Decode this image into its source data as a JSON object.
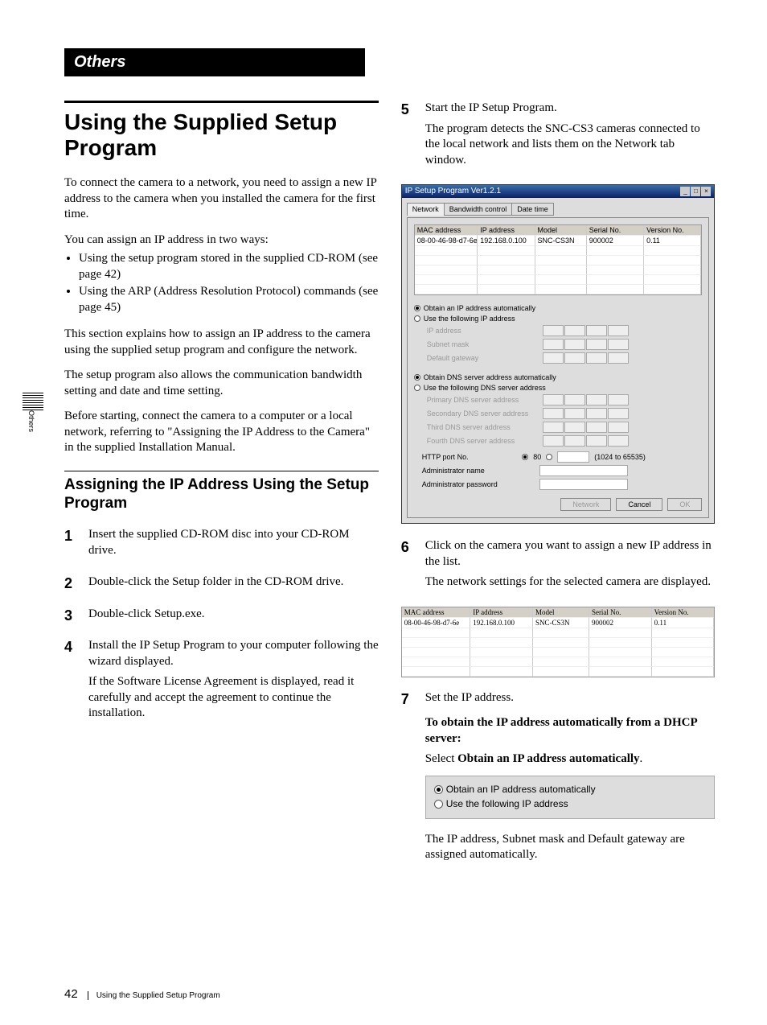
{
  "section_label": "Others",
  "title": "Using the Supplied Setup Program",
  "intro1": "To connect the camera to a network, you need to assign a new IP address to the camera when you installed the camera for the first time.",
  "intro2": "You can assign an IP address in two ways:",
  "bullets": [
    "Using the setup program stored in the supplied CD-ROM (see page 42)",
    "Using the ARP (Address Resolution Protocol) commands (see page 45)"
  ],
  "intro3": "This section explains how to assign an IP address to the camera using the supplied setup program and configure the network.",
  "intro4": "The setup program also allows the communication bandwidth setting and date and time setting.",
  "intro5": "Before starting, connect the camera to a computer or a local network, referring to \"Assigning the IP Address to the Camera\" in the supplied Installation Manual.",
  "subtitle": "Assigning the IP Address Using the Setup Program",
  "steps": {
    "s1": "Insert the supplied CD-ROM disc into your CD-ROM drive.",
    "s2": "Double-click the Setup folder in the CD-ROM drive.",
    "s3": "Double-click Setup.exe.",
    "s4a": "Install the IP Setup Program to your computer following the wizard displayed.",
    "s4b": "If the Software License Agreement is displayed, read it carefully and accept the agreement to continue the installation.",
    "s5a": "Start the IP Setup Program.",
    "s5b": "The program detects the SNC-CS3 cameras connected to the local network and lists them on the Network tab window.",
    "s6a": "Click on the camera you want to assign a new IP address in the list.",
    "s6b": "The network settings for the selected camera are displayed.",
    "s7": "Set the IP address.",
    "s7_heading": "To obtain the IP address automatically from a DHCP server:",
    "s7_select_prefix": "Select ",
    "s7_select_bold": "Obtain an IP address automatically",
    "s7_select_suffix": ".",
    "s7_after": "The IP address, Subnet mask and Default gateway are assigned automatically."
  },
  "window": {
    "title": "IP Setup Program Ver1.2.1",
    "tabs": [
      "Network",
      "Bandwidth control",
      "Date time"
    ],
    "cols": [
      "MAC address",
      "IP address",
      "Model",
      "Serial No.",
      "Version No."
    ],
    "row": [
      "08-00-46-98-d7-6e",
      "192.168.0.100",
      "SNC-CS3N",
      "900002",
      "0.11"
    ],
    "r_obtain_ip": "Obtain an IP address automatically",
    "r_use_ip": "Use the following IP address",
    "fld_ip": "IP address",
    "fld_subnet": "Subnet mask",
    "fld_gateway": "Default gateway",
    "r_obtain_dns": "Obtain DNS server address automatically",
    "r_use_dns": "Use the following DNS server address",
    "fld_dns1": "Primary DNS server address",
    "fld_dns2": "Secondary DNS server address",
    "fld_dns3": "Third DNS server address",
    "fld_dns4": "Fourth DNS server address",
    "http_port": "HTTP port No.",
    "port80": "80",
    "port_range": "(1024 to 65535)",
    "admin_name": "Administrator name",
    "admin_pass": "Administrator password",
    "btn_network": "Network",
    "btn_cancel": "Cancel",
    "btn_ok": "OK"
  },
  "small_shot": {
    "opt1": "Obtain an IP address automatically",
    "opt2": "Use the following IP address"
  },
  "side_tab": "Others",
  "page_number": "42",
  "footer_text": "Using the Supplied Setup Program"
}
